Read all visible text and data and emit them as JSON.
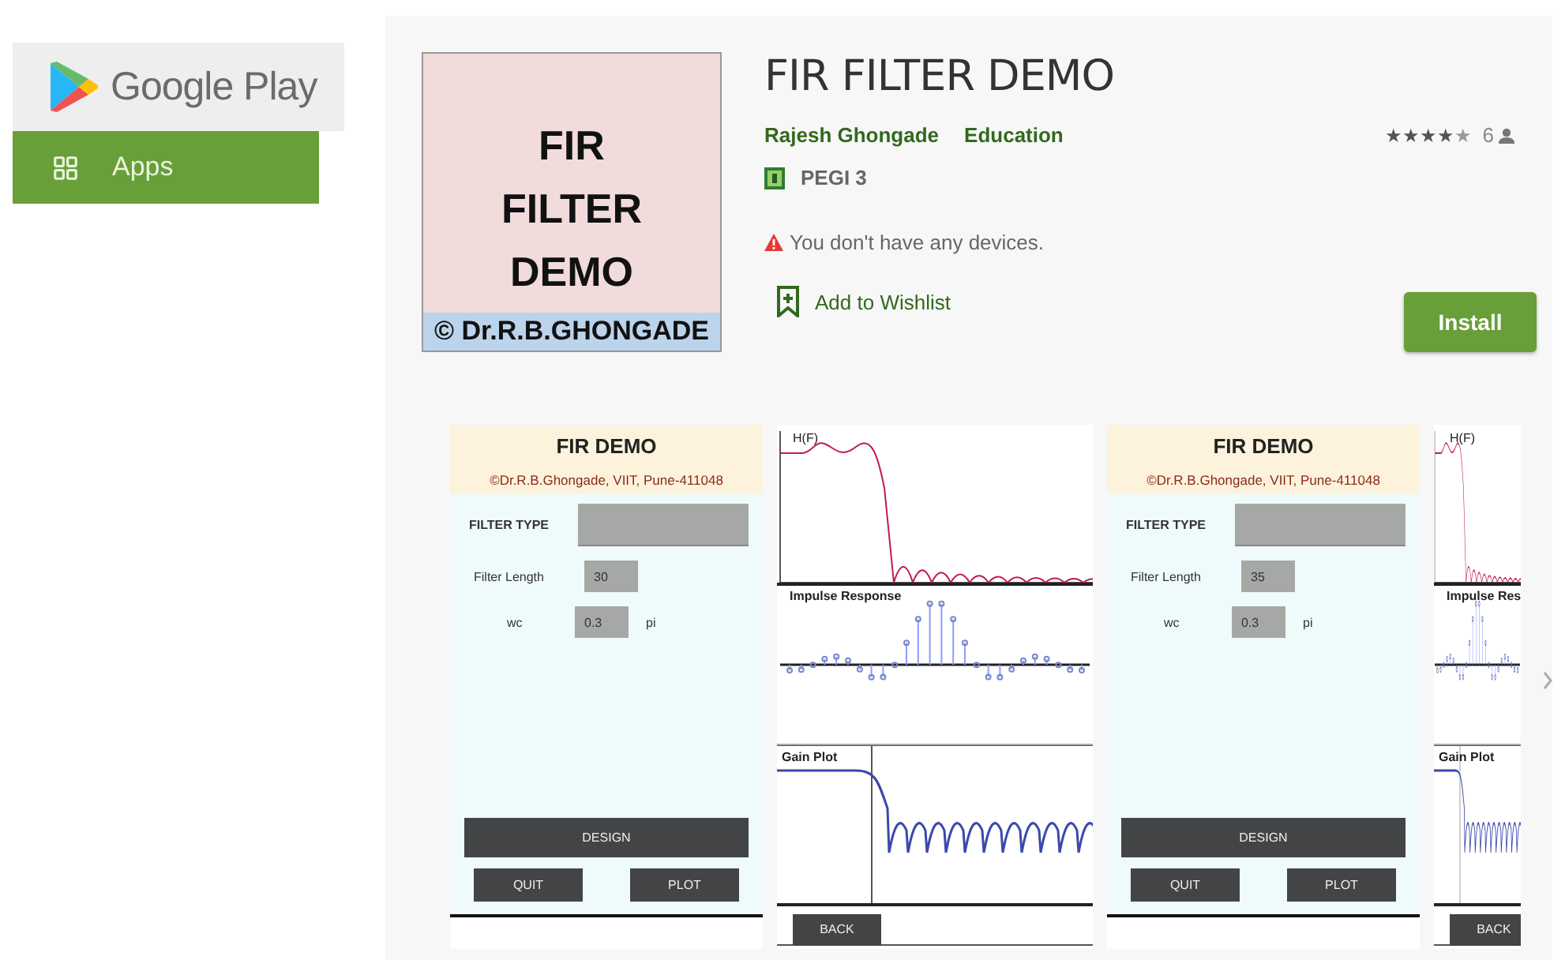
{
  "store": {
    "logo_text": "Google Play",
    "nav": [
      {
        "label": "Apps",
        "selected": true
      }
    ]
  },
  "app": {
    "icon_title": "FIR FILTER DEMO",
    "icon_credit": "© Dr.R.B.GHONGADE",
    "title": "FIR FILTER DEMO",
    "developer": "Rajesh Ghongade",
    "category": "Education",
    "content_rating": "PEGI 3",
    "stars": 4,
    "rating_count": "6",
    "device_warning": "You don't have any devices.",
    "wishlist": "Add to Wishlist",
    "install": "Install"
  },
  "screenshots": [
    {
      "kind": "form",
      "title": "FIR DEMO",
      "subtitle": "©Dr.R.B.Ghongade, VIIT, Pune-411048",
      "filter_type_label": "FILTER TYPE",
      "length_label": "Filter Length",
      "length_value": "30",
      "wc_label": "wc",
      "wc_value": "0.3",
      "wc_unit": "pi",
      "design": "DESIGN",
      "quit": "QUIT",
      "plot": "PLOT"
    },
    {
      "kind": "plots",
      "h_label": "H(F)",
      "impulse_title": "Impulse Response",
      "gain_title": "Gain Plot",
      "back": "BACK"
    },
    {
      "kind": "form",
      "title": "FIR DEMO",
      "subtitle": "©Dr.R.B.Ghongade, VIIT, Pune-411048",
      "filter_type_label": "FILTER TYPE",
      "length_label": "Filter Length",
      "length_value": "35",
      "wc_label": "wc",
      "wc_value": "0.3",
      "wc_unit": "pi",
      "design": "DESIGN",
      "quit": "QUIT",
      "plot": "PLOT"
    },
    {
      "kind": "plots_cut",
      "h_label": "H(F)",
      "impulse_title": "Impulse Res",
      "gain_title": "Gain Plot",
      "back": "BACK"
    }
  ]
}
